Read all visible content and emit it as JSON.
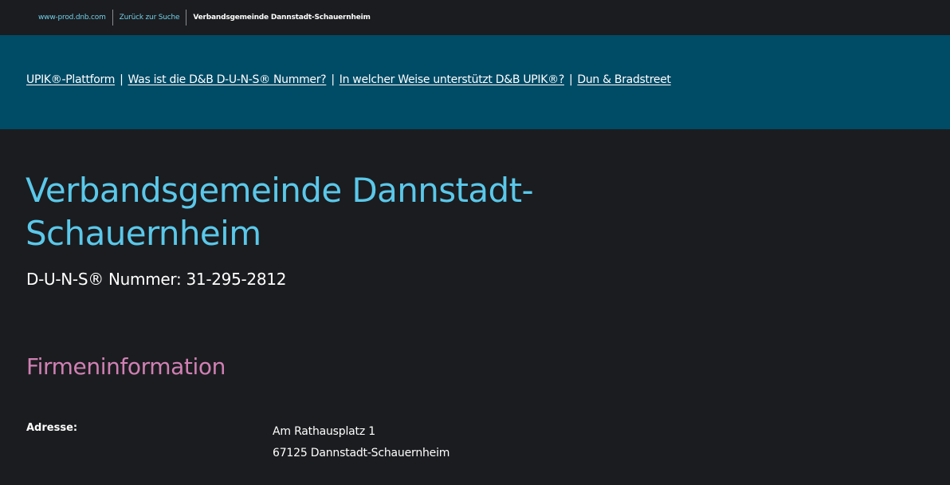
{
  "breadcrumb": {
    "home": "www-prod.dnb.com",
    "back": "Zurück zur Suche",
    "current": "Verbandsgemeinde Dannstadt-Schauernheim"
  },
  "nav": {
    "links": [
      "UPIK®-Plattform",
      "Was ist die D&B D-U-N-S® Nummer?",
      "In welcher Weise unterstützt D&B UPIK®?",
      "Dun & Bradstreet"
    ],
    "separator": "|"
  },
  "company": {
    "name": "Verbandsgemeinde Dannstadt-Schauernheim",
    "duns_label": "D-U-N-S® Nummer: 31-295-2812"
  },
  "firmeninformation": {
    "title": "Firmeninformation",
    "address_label": "Adresse:",
    "address_lines": [
      "Am Rathausplatz 1",
      "67125 Dannstadt-Schauernheim"
    ]
  },
  "colors": {
    "background": "#1b1c1f",
    "nav_band": "#004b66",
    "company_name": "#5ac8ea",
    "section_title": "#d080b4",
    "breadcrumb_link": "#6fd0ea"
  }
}
